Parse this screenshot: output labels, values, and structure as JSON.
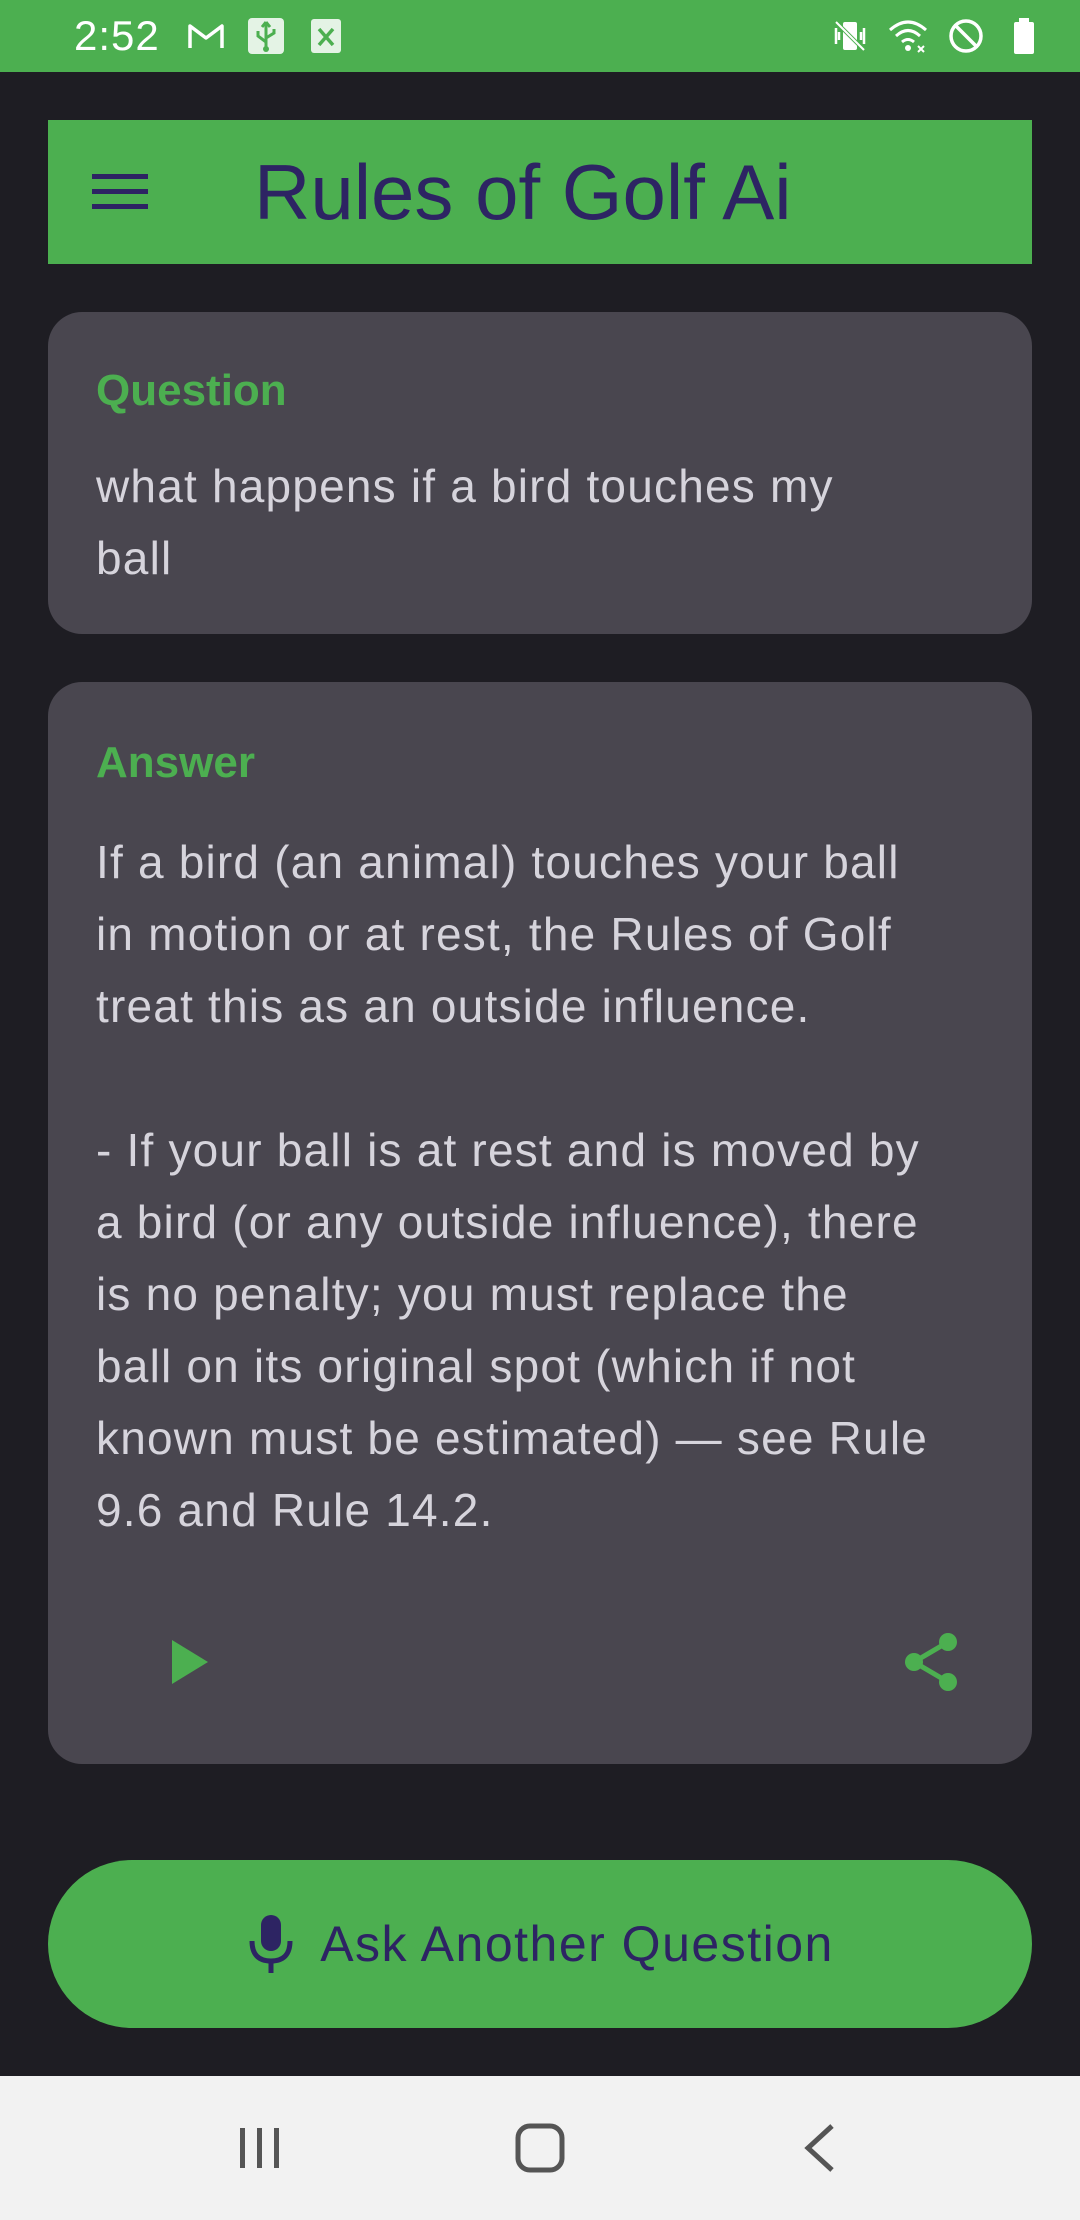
{
  "status_bar": {
    "time": "2:52",
    "left_icons": [
      "gmail-icon",
      "usb-icon",
      "excel-icon"
    ],
    "right_icons": [
      "vibrate-mute-icon",
      "wifi-icon",
      "do-not-disturb-icon",
      "battery-icon"
    ]
  },
  "app_bar": {
    "title": "Rules of Golf Ai",
    "menu_icon": "hamburger-menu-icon"
  },
  "question_card": {
    "label": "Question",
    "text": "what happens if a bird touches my\nball"
  },
  "answer_card": {
    "label": "Answer",
    "text": "If a bird (an animal) touches your ball\nin motion or at rest, the Rules of Golf\ntreat this as an outside influence.\n\n- If your ball is at rest and is moved by\na bird (or any outside influence), there\nis no penalty; you must replace the\nball on its original spot (which if not\nknown must be estimated) — see Rule\n9.6 and Rule 14.2.",
    "play_icon": "play-icon",
    "share_icon": "share-icon"
  },
  "ask_button": {
    "label": "Ask Another Question",
    "icon": "microphone-icon"
  },
  "nav_bar": {
    "buttons": [
      "recent-apps-icon",
      "home-icon",
      "back-icon"
    ]
  },
  "colors": {
    "accent": "#4caf50",
    "title_text": "#2d2463",
    "background": "#1e1d23",
    "card": "#49464f",
    "card_text": "#d6d4dc",
    "nav_bar": "#f2f2f2"
  }
}
